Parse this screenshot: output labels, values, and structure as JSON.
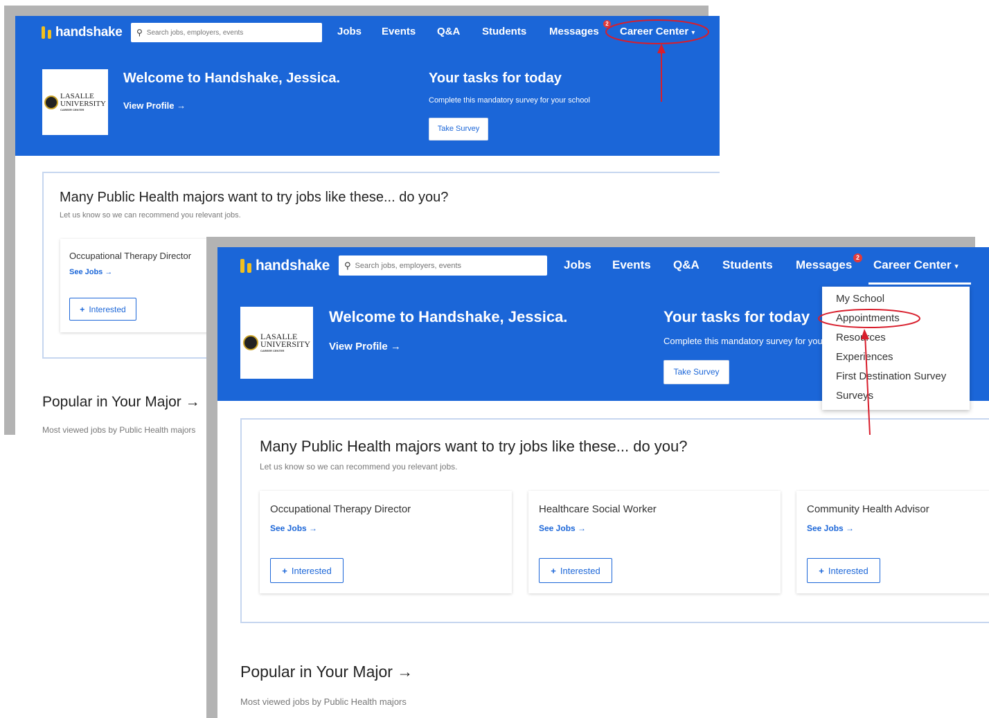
{
  "nav": {
    "brand": "handshake",
    "search_placeholder": "Search jobs, employers, events",
    "links": [
      "Jobs",
      "Events",
      "Q&A",
      "Students",
      "Messages"
    ],
    "messages_badge": "2",
    "career_center": "Career Center",
    "career_center_caret": "▾"
  },
  "hero": {
    "school_name_line1": "LASALLE",
    "school_name_line2": "UNIVERSITY",
    "school_sub": "CAREER CENTER",
    "welcome": "Welcome to Handshake, Jessica.",
    "view_profile": "View Profile →",
    "tasks_title": "Your tasks for today",
    "tasks_note": "Complete this mandatory survey for your school",
    "take_survey": "Take Survey"
  },
  "recommend": {
    "title": "Many Public Health majors want to try jobs like these... do you?",
    "subtitle": "Let us know so we can recommend you relevant jobs.",
    "cards": [
      {
        "title": "Occupational Therapy Director",
        "link": "See Jobs →",
        "button": "Interested"
      },
      {
        "title": "Healthcare Social Worker",
        "link": "See Jobs →",
        "button": "Interested"
      },
      {
        "title": "Community Health Advisor",
        "link": "See Jobs →",
        "button": "Interested"
      }
    ],
    "plus": "+"
  },
  "popular": {
    "title": "Popular in Your Major →",
    "subtitle": "Most viewed jobs by Public Health majors"
  },
  "dropdown": {
    "items": [
      "My School",
      "Appointments",
      "Resources",
      "Experiences",
      "First Destination Survey",
      "Surveys"
    ]
  },
  "colors": {
    "brand_blue": "#1b66d8",
    "annotation_red": "#d81e2c",
    "logo_yellow": "#f2c01e"
  }
}
